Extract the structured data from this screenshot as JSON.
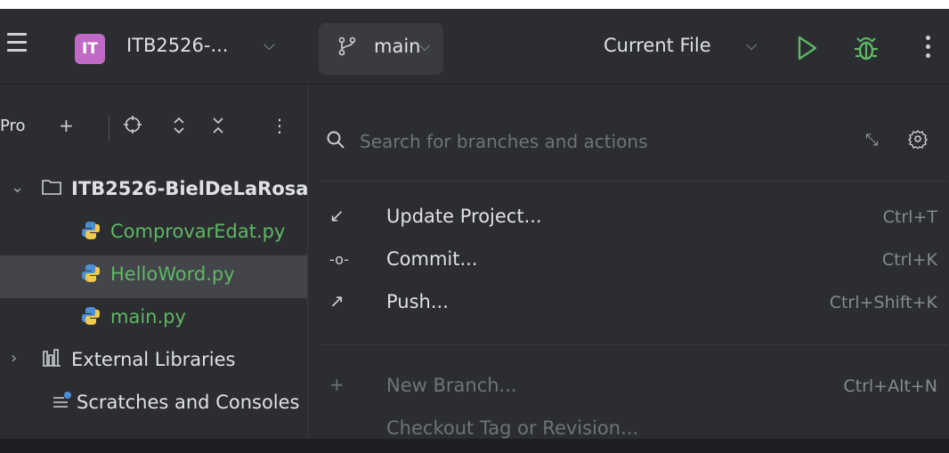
{
  "titlebar": {
    "project_initials": "IT",
    "project_name": "ITB2526-...",
    "branch": "main",
    "run_config": "Current File"
  },
  "sidebar": {
    "title": "Project",
    "items": [
      {
        "label": "ITB2526-BielDeLaRosa",
        "type": "folder"
      },
      {
        "label": "ComprovarEdat.py",
        "type": "python"
      },
      {
        "label": "HelloWord.py",
        "type": "python"
      },
      {
        "label": "main.py",
        "type": "python"
      },
      {
        "label": "External Libraries",
        "type": "library"
      },
      {
        "label": "Scratches and Consoles",
        "type": "scratch"
      }
    ]
  },
  "popup": {
    "search_placeholder": "Search for branches and actions",
    "actions": [
      {
        "icon": "update-icon",
        "glyph": "↙",
        "label": "Update Project...",
        "shortcut": "Ctrl+T"
      },
      {
        "icon": "commit-icon",
        "glyph": "-o-",
        "label": "Commit...",
        "shortcut": "Ctrl+K"
      },
      {
        "icon": "push-icon",
        "glyph": "↗",
        "label": "Push...",
        "shortcut": "Ctrl+Shift+K"
      }
    ],
    "branch_actions": [
      {
        "icon": "plus-icon",
        "glyph": "+",
        "label": "New Branch...",
        "shortcut": "Ctrl+Alt+N"
      },
      {
        "icon": "",
        "glyph": "",
        "label": "Checkout Tag or Revision...",
        "shortcut": ""
      }
    ]
  },
  "colors": {
    "background": "#2b2d30",
    "selection": "#43454a",
    "project_badge": "#c06ac5",
    "run_green": "#5fb865",
    "modified_file": "#5fb865"
  }
}
